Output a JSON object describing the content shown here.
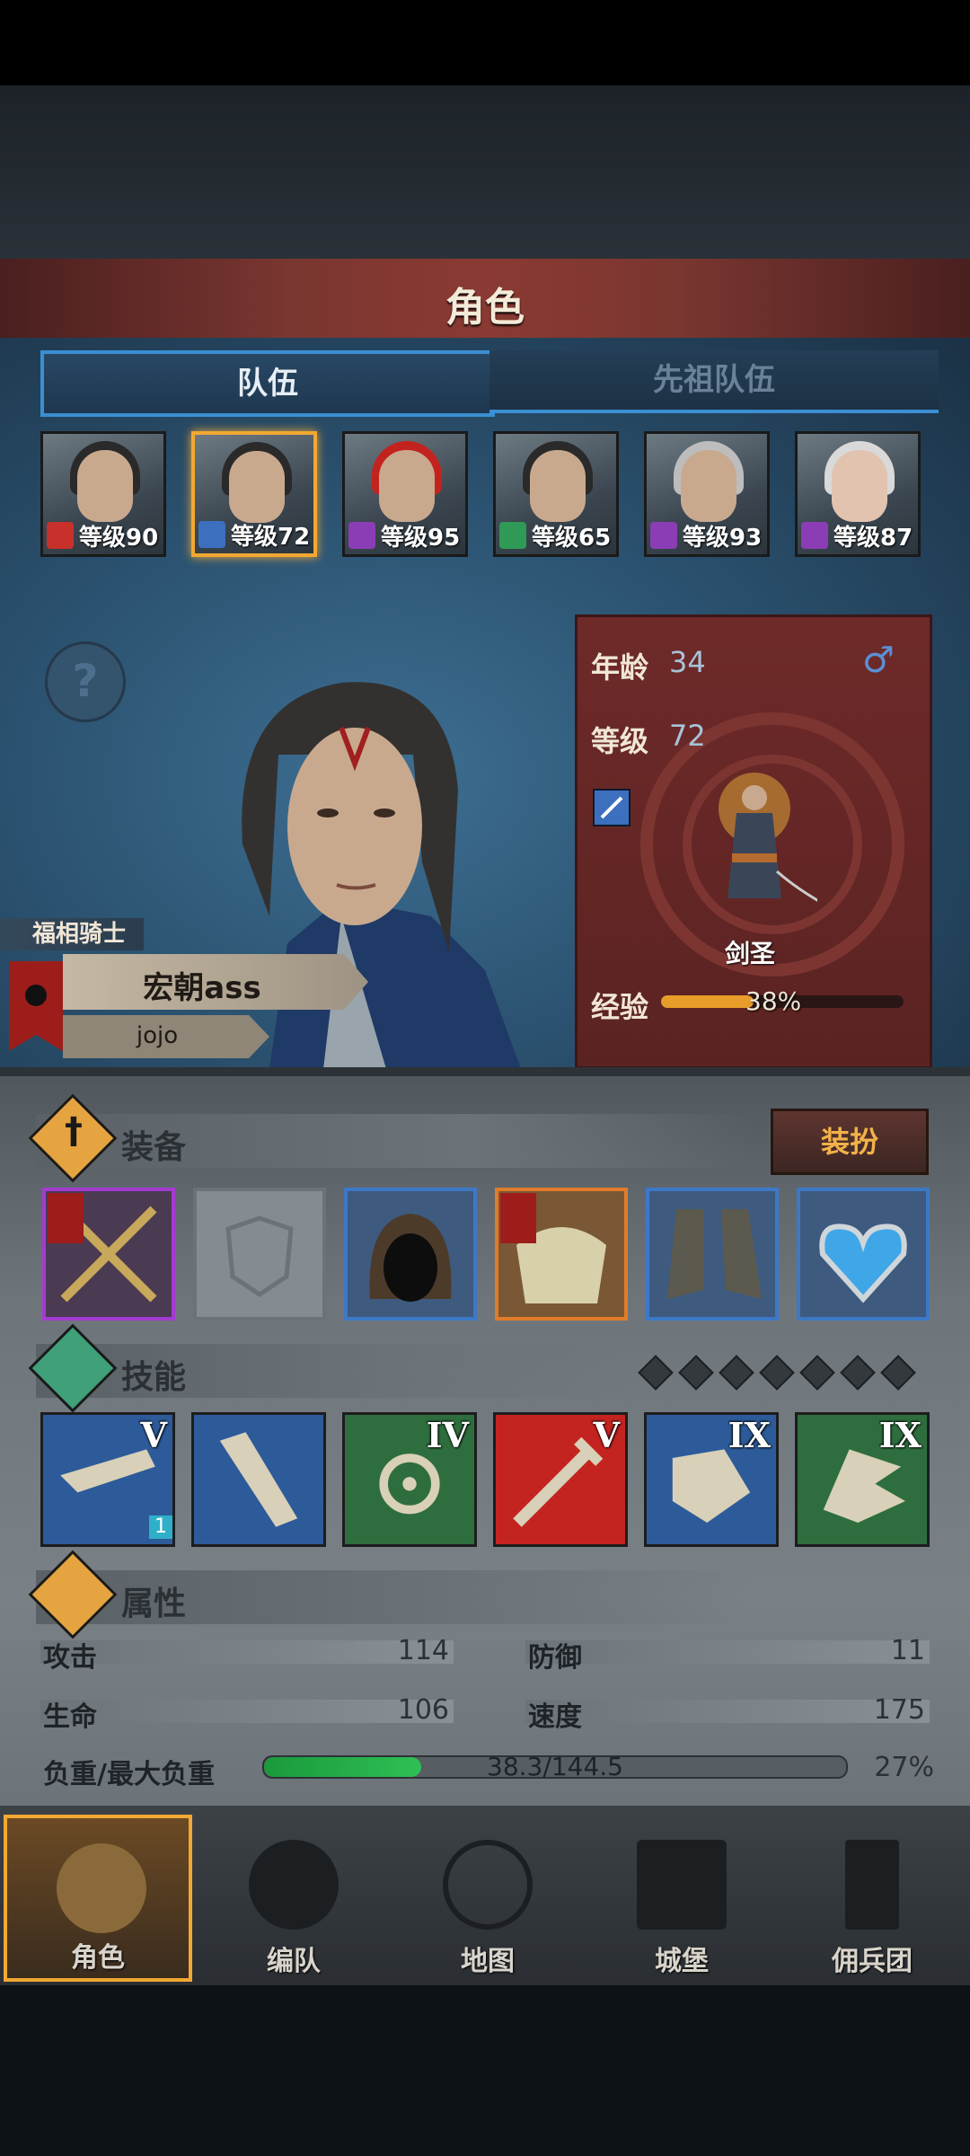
{
  "header": {
    "title": "角色"
  },
  "tabs": [
    {
      "label": "队伍"
    },
    {
      "label": "先祖队伍"
    }
  ],
  "heroes": [
    {
      "level_text": "等级90",
      "class_color": "#c8312b"
    },
    {
      "level_text": "等级72",
      "class_color": "#3d6fbf"
    },
    {
      "level_text": "等级95",
      "class_color": "#8a3db4"
    },
    {
      "level_text": "等级65",
      "class_color": "#2f9a55"
    },
    {
      "level_text": "等级93",
      "class_color": "#8a3db4"
    },
    {
      "level_text": "等级87",
      "class_color": "#8a3db4"
    }
  ],
  "character": {
    "title": "福相骑士",
    "name": "宏朝ass",
    "player": "jojo",
    "age_label": "年龄",
    "age": "34",
    "level_label": "等级",
    "level": "72",
    "class_name": "剑圣",
    "exp_label": "经验",
    "exp_percent_text": "38%",
    "exp_fraction": 0.38,
    "gender_icon": "male-icon"
  },
  "equipment": {
    "title": "装备",
    "dress_label": "装扮",
    "slots": [
      {
        "name": "crossed-swords-icon",
        "border": "#a43bd0"
      },
      {
        "name": "empty-shield-icon",
        "border": "#6b7278"
      },
      {
        "name": "hood-icon",
        "border": "#3d78c7"
      },
      {
        "name": "armor-icon",
        "border": "#e07c2a"
      },
      {
        "name": "boots-icon",
        "border": "#3d78c7"
      },
      {
        "name": "heart-amulet-icon",
        "border": "#3d78c7"
      }
    ]
  },
  "skills": {
    "title": "技能",
    "items": [
      {
        "rank": "V",
        "bg": "#2d5b9a"
      },
      {
        "rank": "",
        "bg": "#2d5b9a"
      },
      {
        "rank": "IV",
        "bg": "#2e6e3e"
      },
      {
        "rank": "V",
        "bg": "#c42420"
      },
      {
        "rank": "IX",
        "bg": "#2d5b9a"
      },
      {
        "rank": "IX",
        "bg": "#2e6e3e"
      }
    ],
    "badge": "1"
  },
  "attributes": {
    "title": "属性",
    "attack_label": "攻击",
    "attack": "114",
    "defense_label": "防御",
    "defense": "11",
    "hp_label": "生命",
    "hp": "106",
    "speed_label": "速度",
    "speed": "175",
    "load_label": "负重/最大负重",
    "load_text": "38.3/144.5",
    "load_percent_text": "27%",
    "load_fraction": 0.27
  },
  "nav": [
    {
      "label": "角色",
      "icon": "knight-icon"
    },
    {
      "label": "编队",
      "icon": "helmet-icon"
    },
    {
      "label": "地图",
      "icon": "compass-icon"
    },
    {
      "label": "城堡",
      "icon": "castle-icon"
    },
    {
      "label": "佣兵团",
      "icon": "banner-icon"
    }
  ]
}
